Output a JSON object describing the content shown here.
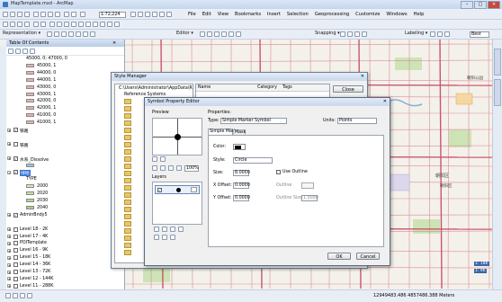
{
  "window": {
    "title": "MapTemplate.mxd - ArcMap",
    "min": "–",
    "max": "□",
    "close": "✕"
  },
  "menu": [
    "File",
    "Edit",
    "View",
    "Bookmarks",
    "Insert",
    "Selection",
    "Geoprocessing",
    "Customize",
    "Windows",
    "Help"
  ],
  "toolbar1": {
    "scale": "1:72,224"
  },
  "toolbar2": {
    "representation": "Representation ▾",
    "editor": "Editor ▾",
    "snapping": "Snapping ▾",
    "labeling": "Labeling ▾",
    "best": "Best"
  },
  "toc": {
    "title": "Table Of Contents",
    "items": [
      {
        "label": "45000, 0; 47000, 0",
        "indent": 2,
        "swatch": "none"
      },
      {
        "label": "45000, 1",
        "indent": 2,
        "swatch": "#e8b0b0"
      },
      {
        "label": "44000, 0",
        "indent": 2,
        "swatch": "#e8b0b0"
      },
      {
        "label": "44000, 1",
        "indent": 2,
        "swatch": "#e8b0b0"
      },
      {
        "label": "43000, 0",
        "indent": 2,
        "swatch": "#e8b0b0"
      },
      {
        "label": "43000, 1",
        "indent": 2,
        "swatch": "#e8b0b0"
      },
      {
        "label": "42000, 0",
        "indent": 2,
        "swatch": "#e8b0b0"
      },
      {
        "label": "42000, 1",
        "indent": 2,
        "swatch": "#e8b0b0"
      },
      {
        "label": "41000, 0",
        "indent": 2,
        "swatch": "#e8b0b0"
      },
      {
        "label": "41000, 1",
        "indent": 2,
        "swatch": "#e8b0b0"
      },
      {
        "label": "铁路",
        "indent": 1,
        "check": true,
        "expand": "+"
      },
      {
        "label": "",
        "indent": 1,
        "swatch": "none"
      },
      {
        "label": "铁路",
        "indent": 1,
        "check": false,
        "expand": "+"
      },
      {
        "label": "",
        "indent": 1,
        "swatch": "none"
      },
      {
        "label": "水系_Dissolve",
        "indent": 1,
        "check": true,
        "expand": "+"
      },
      {
        "label": "",
        "indent": 2,
        "swatch": "#9cc3e6"
      },
      {
        "label": "绿地",
        "indent": 1,
        "check": true,
        "expand": "−",
        "highlight": true
      },
      {
        "label": "TYPE",
        "indent": 2,
        "swatch": "none"
      },
      {
        "label": "2000",
        "indent": 2,
        "swatch": "#d7eab8"
      },
      {
        "label": "2020",
        "indent": 2,
        "swatch": "#c5e0a0"
      },
      {
        "label": "2030",
        "indent": 2,
        "swatch": "#b7d98e"
      },
      {
        "label": "2040",
        "indent": 2,
        "swatch": "#a9cf7f"
      },
      {
        "label": "AdminBndy5",
        "indent": 1,
        "check": true,
        "expand": "+"
      },
      {
        "label": "",
        "indent": 1,
        "swatch": "none"
      },
      {
        "label": "Level 18 - 2K",
        "indent": 1,
        "check": false,
        "expand": "+"
      },
      {
        "label": "Level 17 - 4K",
        "indent": 1,
        "check": false,
        "expand": "+"
      },
      {
        "label": "POITemplate",
        "indent": 1,
        "check": false,
        "expand": "+"
      },
      {
        "label": "Level 16 - 9K",
        "indent": 1,
        "check": false,
        "expand": "+"
      },
      {
        "label": "Level 15 - 18K",
        "indent": 1,
        "check": false,
        "expand": "+"
      },
      {
        "label": "Level 14 - 36K",
        "indent": 1,
        "check": false,
        "expand": "+"
      },
      {
        "label": "Level 13 - 72K",
        "indent": 1,
        "check": false,
        "expand": "+"
      },
      {
        "label": "Level 12 - 144K",
        "indent": 1,
        "check": false,
        "expand": "+"
      },
      {
        "label": "Level 11 - 288K",
        "indent": 1,
        "check": false,
        "expand": "+"
      }
    ]
  },
  "style_manager": {
    "title": "Style Manager",
    "path": "C:\\Users\\Administrator\\AppData\\R",
    "ref": "Reference Systems",
    "cols": [
      "Name",
      "Category",
      "Tags"
    ],
    "close": "Close"
  },
  "spe": {
    "title": "Symbol Property Editor",
    "preview": "Preview",
    "zoom": "100%",
    "layers": "Layers",
    "properties": "Properties:",
    "type_label": "Type:",
    "type_value": "Simple Marker Symbol",
    "units_label": "Units:",
    "units_value": "Points",
    "tabs": [
      "Simple Marker",
      "Mask"
    ],
    "color_label": "Color:",
    "style_label": "Style:",
    "style_value": "Circle",
    "size_label": "Size:",
    "size_value": "8.0000",
    "xoff_label": "X Offset:",
    "xoff_value": "0.0000",
    "yoff_label": "Y Offset:",
    "yoff_value": "0.0000",
    "use_outline": "Use Outline",
    "outline_label": "Outline",
    "outline_size_label": "Outline Size:",
    "outline_size_value": "1.0000",
    "ok": "OK",
    "cancel": "Cancel"
  },
  "map": {
    "labels": [
      "朝阳区",
      "朝阳区",
      "朝阳公园",
      "东城区",
      "丰台区",
      "石景山"
    ],
    "scale_badge": "1: 18K",
    "scale_badge2": "1: 9K"
  },
  "status": {
    "coords": "12949483.486  4857486.388 Meters"
  }
}
